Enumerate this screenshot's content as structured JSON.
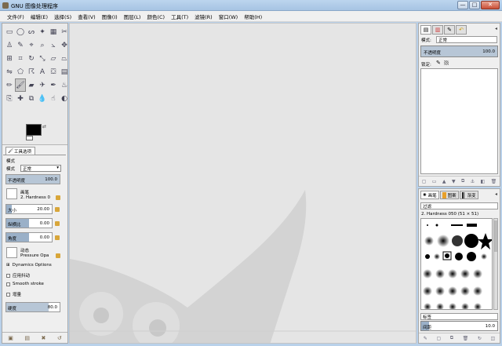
{
  "window": {
    "title": "GNU 图像处理程序",
    "minimize": "—",
    "maximize": "□",
    "close": "✕"
  },
  "menubar": [
    {
      "label": "文件(F)"
    },
    {
      "label": "编辑(E)"
    },
    {
      "label": "选择(S)"
    },
    {
      "label": "查看(V)"
    },
    {
      "label": "图像(I)"
    },
    {
      "label": "图层(L)"
    },
    {
      "label": "颜色(C)"
    },
    {
      "label": "工具(T)"
    },
    {
      "label": "滤镜(R)"
    },
    {
      "label": "窗口(W)"
    },
    {
      "label": "帮助(H)"
    }
  ],
  "toolbox": {
    "tools": [
      {
        "name": "rect-select-icon",
        "glyph": "▭"
      },
      {
        "name": "ellipse-select-icon",
        "glyph": "◯"
      },
      {
        "name": "free-select-icon",
        "glyph": "ᔕ"
      },
      {
        "name": "fuzzy-select-icon",
        "glyph": "✦"
      },
      {
        "name": "color-select-icon",
        "glyph": "▦"
      },
      {
        "name": "scissors-icon",
        "glyph": "✂"
      },
      {
        "name": "foreground-select-icon",
        "glyph": "♙"
      },
      {
        "name": "paths-icon",
        "glyph": "✎"
      },
      {
        "name": "color-picker-icon",
        "glyph": "⌖"
      },
      {
        "name": "zoom-icon",
        "glyph": "⌕"
      },
      {
        "name": "measure-icon",
        "glyph": "⦣"
      },
      {
        "name": "move-icon",
        "glyph": "✥"
      },
      {
        "name": "align-icon",
        "glyph": "⊞"
      },
      {
        "name": "crop-icon",
        "glyph": "⌗"
      },
      {
        "name": "rotate-icon",
        "glyph": "↻"
      },
      {
        "name": "scale-icon",
        "glyph": "⤡"
      },
      {
        "name": "shear-icon",
        "glyph": "▱"
      },
      {
        "name": "perspective-icon",
        "glyph": "⏢"
      },
      {
        "name": "flip-icon",
        "glyph": "⇋"
      },
      {
        "name": "cage-icon",
        "glyph": "⬠"
      },
      {
        "name": "warp-icon",
        "glyph": "☈"
      },
      {
        "name": "text-icon",
        "glyph": "A"
      },
      {
        "name": "bucket-fill-icon",
        "glyph": "⛋"
      },
      {
        "name": "blend-icon",
        "glyph": "▤"
      },
      {
        "name": "pencil-icon",
        "glyph": "✏"
      },
      {
        "name": "paintbrush-icon",
        "glyph": "🖌"
      },
      {
        "name": "eraser-icon",
        "glyph": "▰"
      },
      {
        "name": "airbrush-icon",
        "glyph": "✈"
      },
      {
        "name": "ink-icon",
        "glyph": "✒"
      },
      {
        "name": "mypaint-brush-icon",
        "glyph": "♨"
      },
      {
        "name": "clone-icon",
        "glyph": "⎘"
      },
      {
        "name": "heal-icon",
        "glyph": "✚"
      },
      {
        "name": "perspective-clone-icon",
        "glyph": "⧉"
      },
      {
        "name": "blur-icon",
        "glyph": "💧"
      },
      {
        "name": "smudge-icon",
        "glyph": "☝"
      },
      {
        "name": "dodge-burn-icon",
        "glyph": "◐"
      }
    ]
  },
  "tool_options": {
    "tab_label": "工具选项",
    "section_label": "模式",
    "mode_label": "模式",
    "mode_value": "正常",
    "opacity_label": "不透明度",
    "opacity_value": "100.0",
    "brush_label": "画笔",
    "brush_value": "2. Hardness 0",
    "size_label": "大小",
    "size_value": "20.00",
    "aspect_label": "纵横比",
    "aspect_value": "0.00",
    "angle_label": "角度",
    "angle_value": "0.00",
    "dynamics_label": "动态",
    "dynamics_value": "Pressure Opa",
    "dynamics_options": "Dynamics Options",
    "jitter_label": "应用抖动",
    "smooth_label": "Smooth stroke",
    "incremental_label": "增量",
    "hardness_label": "硬度",
    "hardness_value": "80.0"
  },
  "layers": {
    "mode_label": "模式:",
    "mode_value": "正常",
    "opacity_label": "不透明度",
    "opacity_value": "100.0",
    "lock_label": "锁定:"
  },
  "brushes": {
    "tab_brushes": "画笔",
    "tab_patterns": "图案",
    "tab_gradients": "渐变",
    "filter_placeholder": "过滤",
    "current_brush": "2. Hardness 050 (51 × 51)",
    "tag_placeholder": "标签",
    "spacing_label": "间距",
    "spacing_value": "10.0"
  }
}
